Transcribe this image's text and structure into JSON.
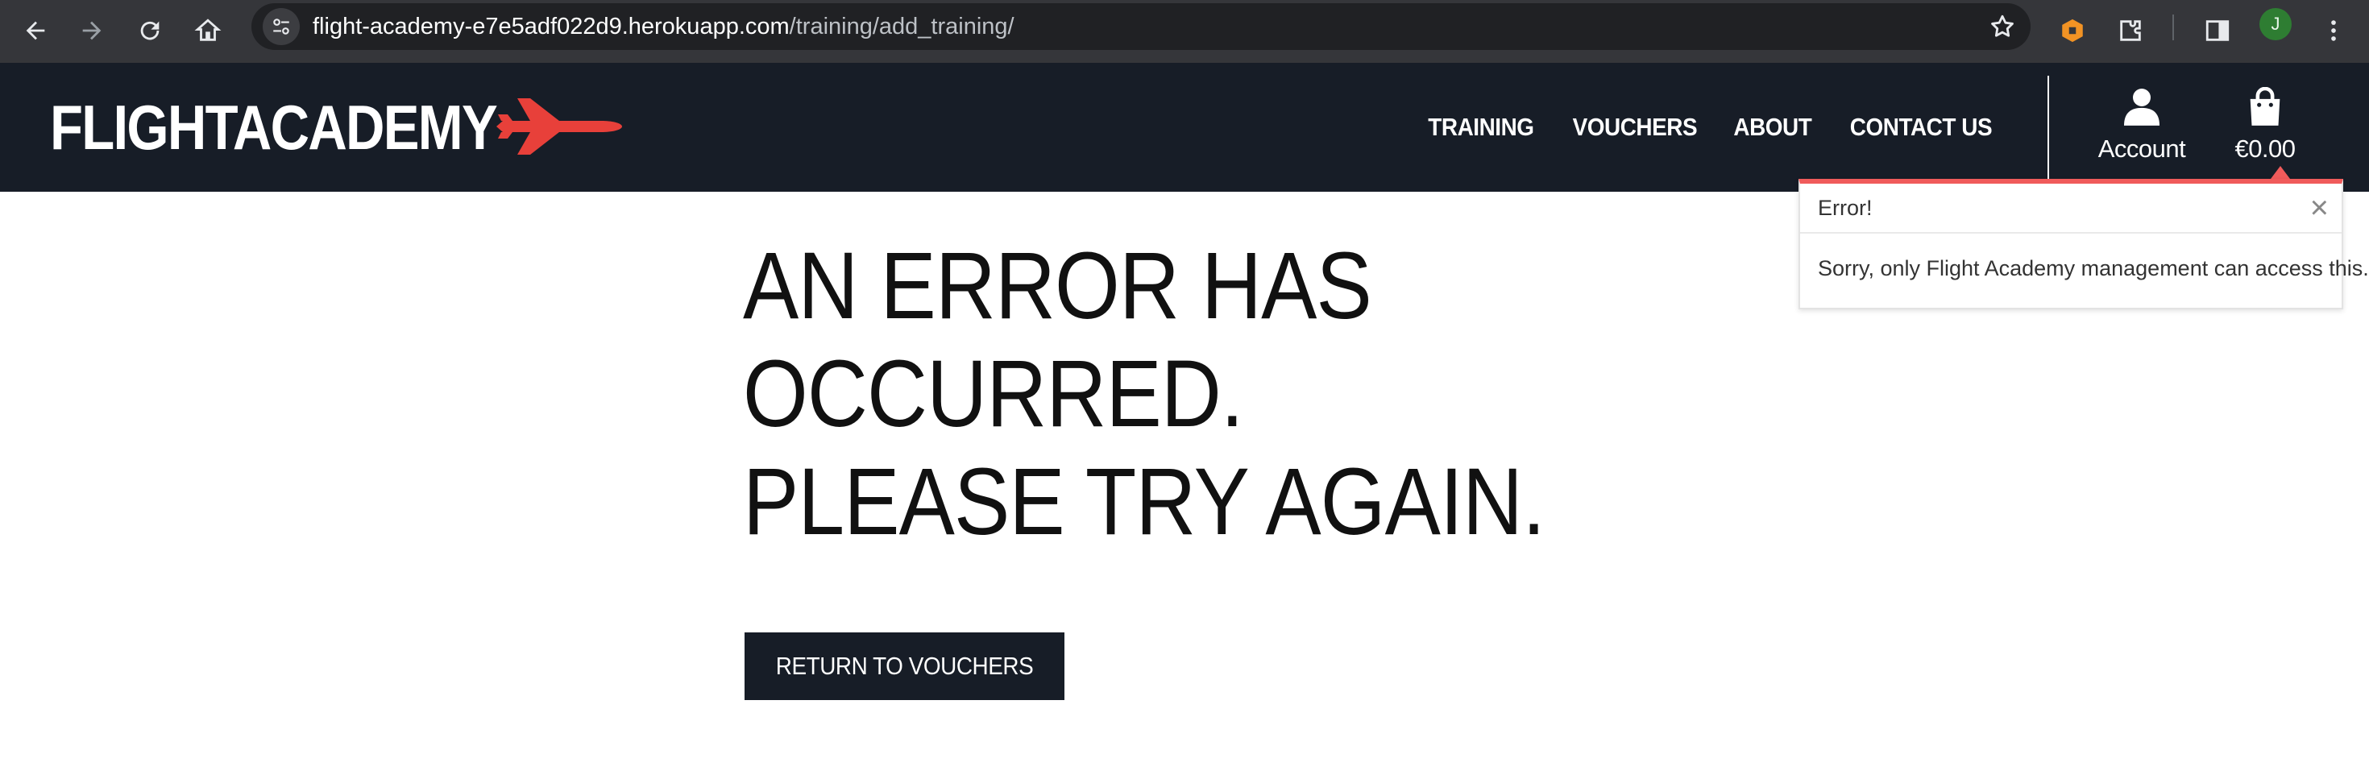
{
  "browser": {
    "url_host": "flight-academy-e7e5adf022d9.herokuapp.com",
    "url_path": "/training/add_training/",
    "profile_initial": "J",
    "icons": [
      "back-arrow-icon",
      "forward-arrow-icon",
      "reload-icon",
      "home-icon",
      "site-settings-icon",
      "bookmark-star-icon",
      "extension-honey-icon",
      "extensions-puzzle-icon",
      "side-panel-icon",
      "menu-kebab-icon"
    ]
  },
  "header": {
    "logo_text": "FLIGHTACADEMY",
    "logo_icon": "airplane-icon",
    "nav": [
      "TRAINING",
      "VOUCHERS",
      "ABOUT",
      "CONTACT US"
    ],
    "account_label": "Account",
    "cart_total": "€0.00"
  },
  "toast": {
    "title": "Error!",
    "message": "Sorry, only Flight Academy management can access this.",
    "close_symbol": "×"
  },
  "main": {
    "heading": "AN ERROR HAS OCCURRED. PLEASE TRY AGAIN.",
    "button_label": "RETURN TO VOUCHERS"
  },
  "colors": {
    "navbar_bg": "#171d27",
    "accent_red": "#e8403a",
    "toast_border": "#f05b5b",
    "chrome_bg": "#35363a"
  }
}
